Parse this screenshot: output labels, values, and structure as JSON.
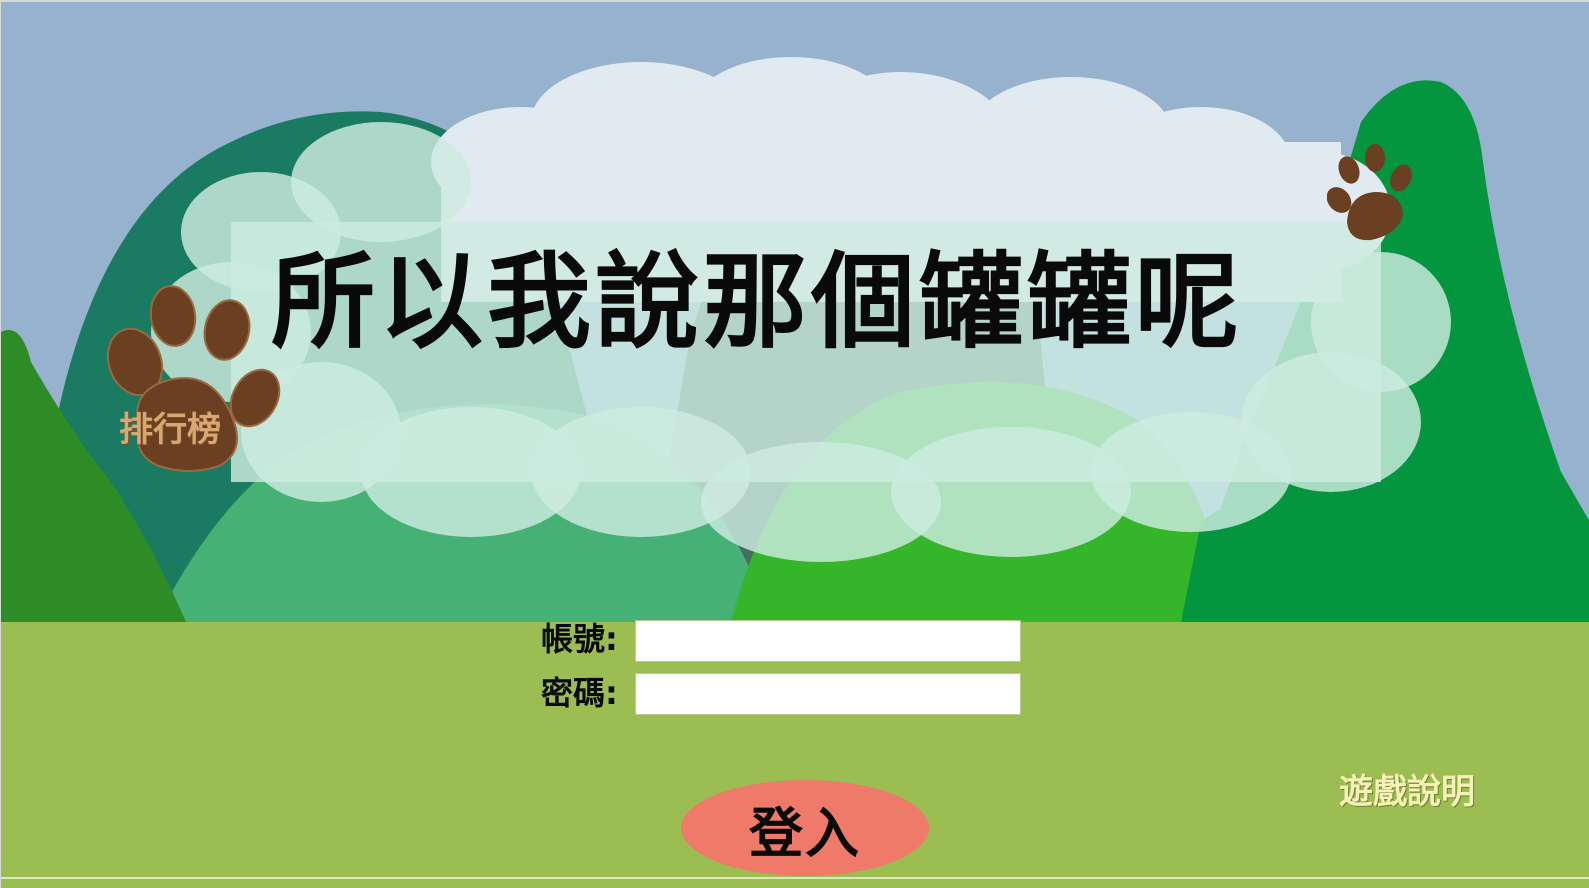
{
  "game": {
    "title": "所以我說那個罐罐呢"
  },
  "ranking": {
    "label": "排行榜",
    "icon": "paw-icon"
  },
  "login_form": {
    "account_label": "帳號:",
    "account_value": "",
    "password_label": "密碼:",
    "password_value": "",
    "submit_label": "登入"
  },
  "help": {
    "label": "遊戲說明"
  },
  "colors": {
    "sky": "#97b2cf",
    "grass": "#9bbd52",
    "paw": "#6b3f22",
    "login_button": "#f07a6a",
    "ranking_text": "#d9a772",
    "help_text": "#f6f1b6"
  }
}
